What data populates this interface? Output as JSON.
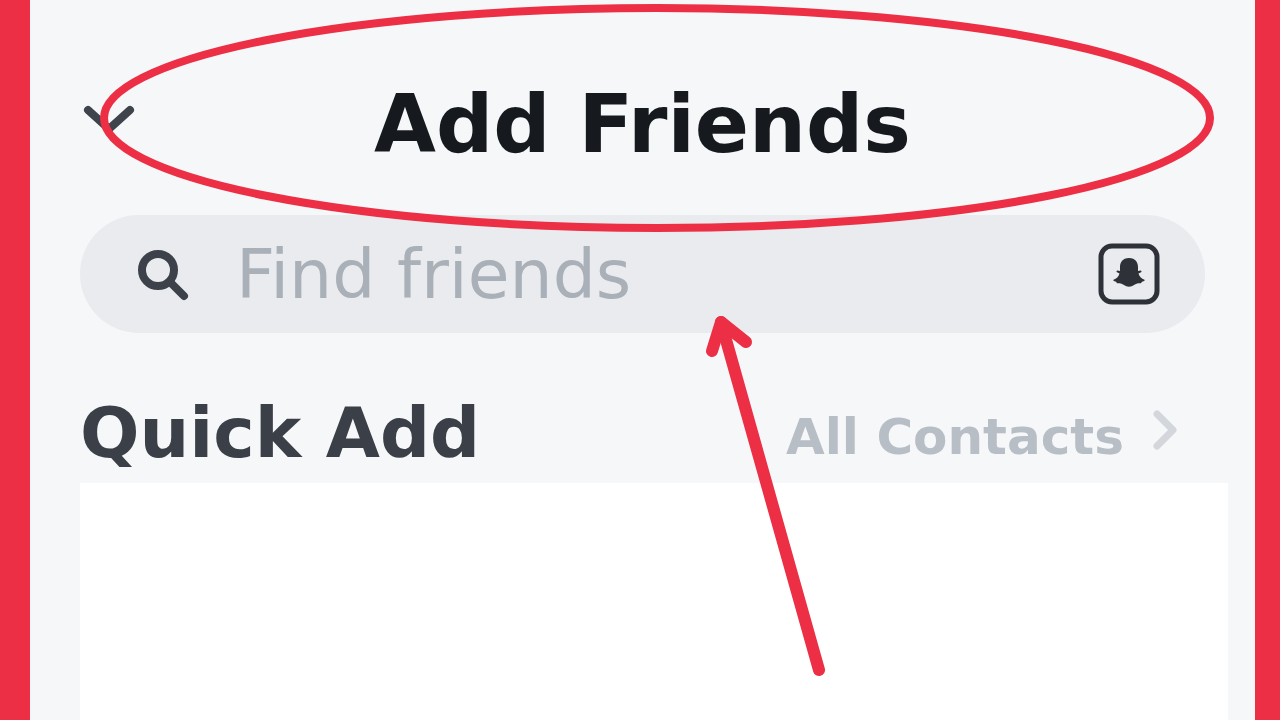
{
  "header": {
    "title": "Add Friends"
  },
  "search": {
    "placeholder": "Find friends"
  },
  "quick_add": {
    "title": "Quick Add",
    "link": "All Contacts"
  }
}
